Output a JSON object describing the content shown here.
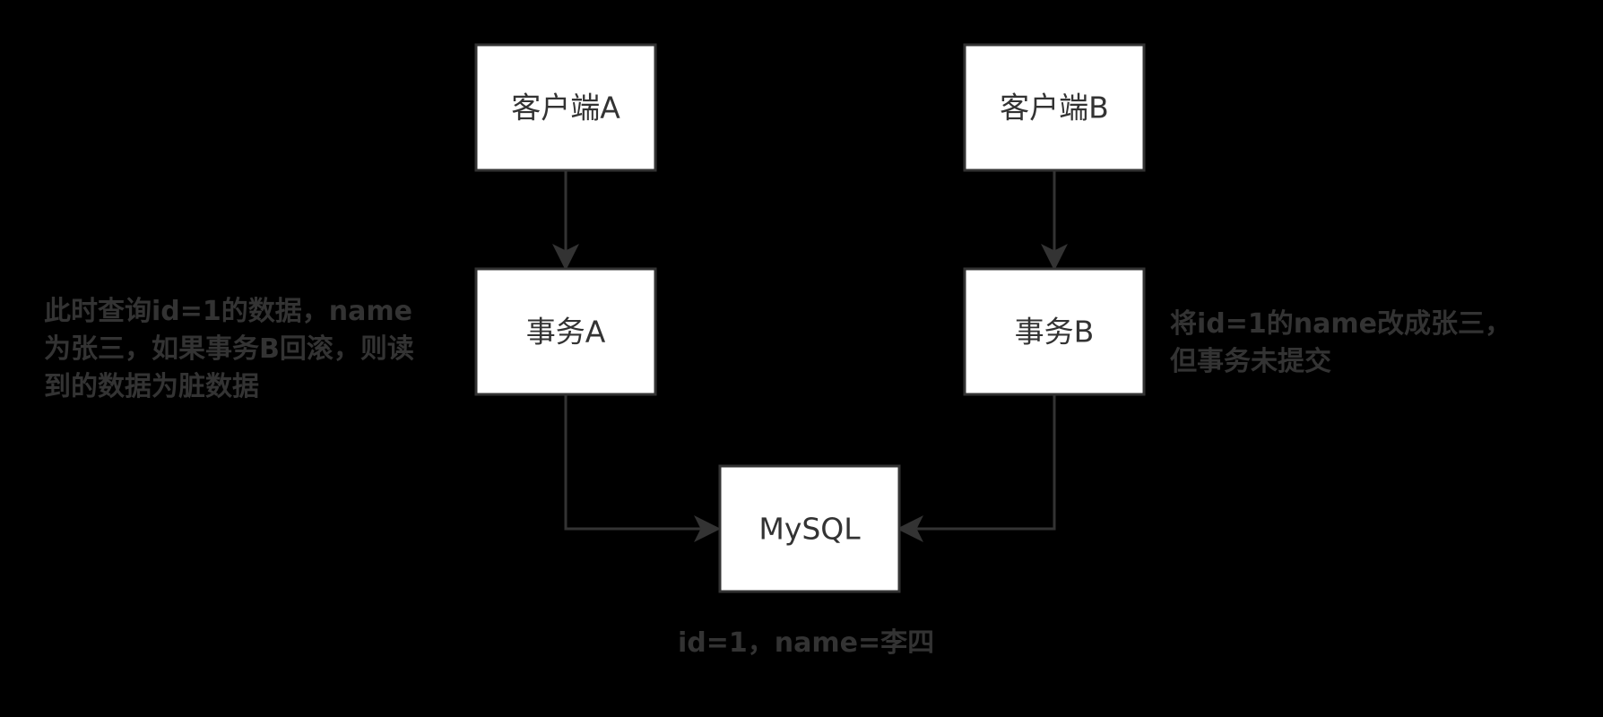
{
  "nodes": {
    "client_a": "客户端A",
    "client_b": "客户端B",
    "txn_a": "事务A",
    "txn_b": "事务B",
    "mysql": "MySQL"
  },
  "notes": {
    "left": [
      "此时查询id=1的数据，name",
      "为张三，如果事务B回滚，则读",
      "到的数据为脏数据"
    ],
    "right": [
      "将id=1的name改成张三，",
      "但事务未提交"
    ],
    "bottom": "id=1，name=李四"
  },
  "colors": {
    "background": "#000000",
    "box_fill": "#ffffff",
    "stroke": "#333333",
    "text": "#333333"
  }
}
